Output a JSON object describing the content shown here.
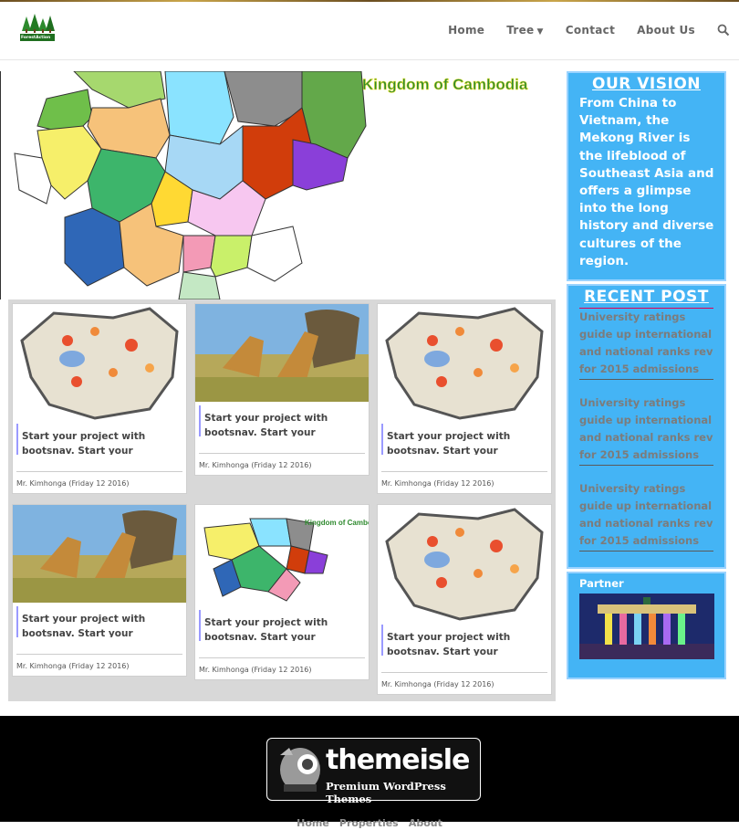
{
  "header": {
    "logo_text": "ForestAction",
    "nav": [
      {
        "label": "Home"
      },
      {
        "label": "Tree"
      },
      {
        "label": "Contact"
      },
      {
        "label": "About Us"
      }
    ]
  },
  "hero": {
    "title": "Kingdom of Cambodia"
  },
  "cards": [
    {
      "text": "Start your project with bootsnav. Start your project...",
      "author": "Mr. Kimhonga",
      "date": "(Friday 12 2016)",
      "image": "cambodia-heatmap"
    },
    {
      "text": "Start your project with bootsnav. Start your project...",
      "author": "Mr. Kimhonga",
      "date": "(Friday 12 2016)",
      "image": "giraffes"
    },
    {
      "text": "Start your project with bootsnav. Start your project...",
      "author": "Mr. Kimhonga",
      "date": "(Friday 12 2016)",
      "image": "cambodia-heatmap"
    },
    {
      "text": "Start your project with bootsnav. Start your project...",
      "author": "Mr. Kimhonga",
      "date": "(Friday 12 2016)",
      "image": "giraffes"
    },
    {
      "text": "Start your project with bootsnav. Start your project...",
      "author": "Mr. Kimhonga",
      "date": "(Friday 12 2016)",
      "image": "province-map"
    },
    {
      "text": "Start your project with bootsnav. Start your project...",
      "author": "Mr. Kimhonga",
      "date": "(Friday 12 2016)",
      "image": "cambodia-heatmap"
    }
  ],
  "sidebar": {
    "vision_title": "OUR VISION",
    "vision_text": "From China to Vietnam, the Mekong River is the lifeblood of Southeast Asia and offers a glimpse into the long history and diverse cultures of the region.",
    "recent_title": "RECENT POST",
    "recent_posts": [
      "University ratings guide up international and national ranks rev for 2015 admissions",
      "University ratings guide up international and national ranks rev for 2015 admissions",
      "University ratings guide up international and national ranks rev for 2015 admissions"
    ],
    "partner_title": "Partner"
  },
  "footer": {
    "brand": "themeisle",
    "tagline": "Premium WordPress Themes",
    "links": [
      "Home",
      "Properties",
      "About"
    ]
  },
  "colors": {
    "sidebar_bg": "#44b4f5",
    "footer_bg": "#000000"
  }
}
